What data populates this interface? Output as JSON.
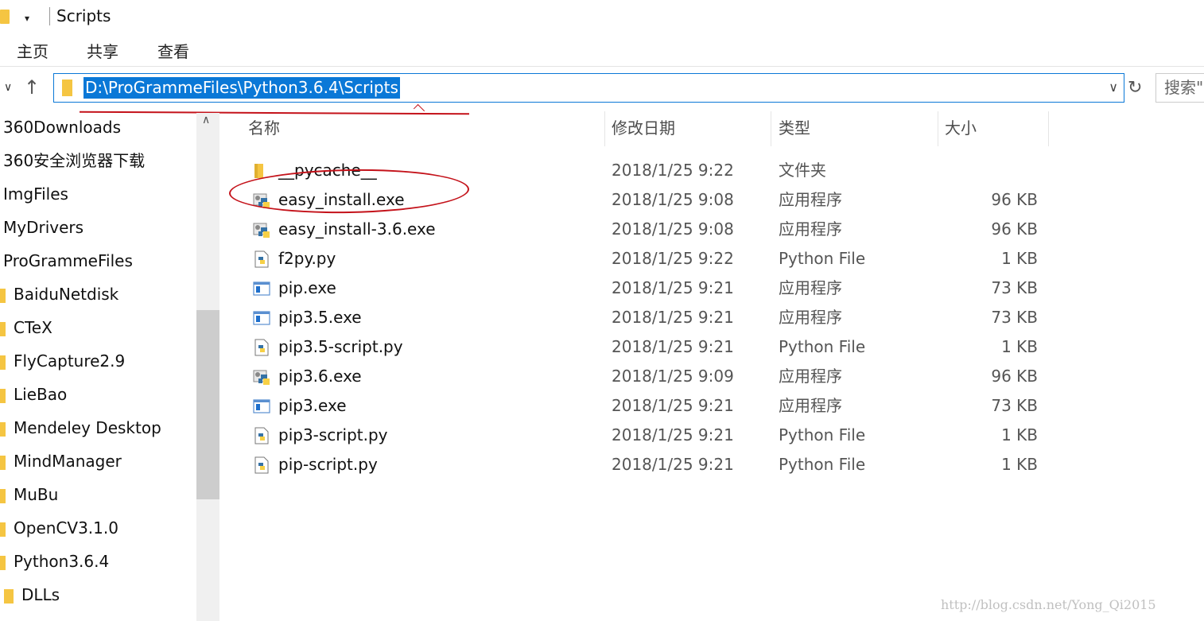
{
  "window": {
    "title": "Scripts",
    "folder_icon": "folder-icon",
    "quick_access_arrow": "▾"
  },
  "ribbon": {
    "tabs": [
      {
        "label": "主页"
      },
      {
        "label": "共享"
      },
      {
        "label": "查看"
      }
    ]
  },
  "address_bar": {
    "path": "D:\\ProGrammeFiles\\Python3.6.4\\Scripts",
    "search_placeholder": "搜索\"",
    "accent_color": "#0a78d7"
  },
  "sidebar": {
    "items": [
      {
        "label": "360Downloads",
        "folder": false
      },
      {
        "label": "360安全浏览器下载",
        "folder": false
      },
      {
        "label": "ImgFiles",
        "folder": false
      },
      {
        "label": "MyDrivers",
        "folder": false
      },
      {
        "label": "ProGrammeFiles",
        "folder": false
      },
      {
        "label": "BaiduNetdisk",
        "folder": true
      },
      {
        "label": "CTeX",
        "folder": true
      },
      {
        "label": "FlyCapture2.9",
        "folder": true
      },
      {
        "label": "LieBao",
        "folder": true
      },
      {
        "label": "Mendeley Desktop",
        "folder": true
      },
      {
        "label": "MindManager",
        "folder": true
      },
      {
        "label": "MuBu",
        "folder": true
      },
      {
        "label": "OpenCV3.1.0",
        "folder": true
      },
      {
        "label": "Python3.6.4",
        "folder": true
      },
      {
        "label": "DLLs",
        "folder": true,
        "sub": true
      }
    ]
  },
  "columns": {
    "name": "名称",
    "date": "修改日期",
    "type": "类型",
    "size": "大小"
  },
  "files": [
    {
      "name": "__pycache__",
      "date": "2018/1/25 9:22",
      "type": "文件夹",
      "size": "",
      "icon": "folder-icon"
    },
    {
      "name": "easy_install.exe",
      "date": "2018/1/25 9:08",
      "type": "应用程序",
      "size": "96 KB",
      "icon": "python-exe-icon"
    },
    {
      "name": "easy_install-3.6.exe",
      "date": "2018/1/25 9:08",
      "type": "应用程序",
      "size": "96 KB",
      "icon": "python-exe-icon"
    },
    {
      "name": "f2py.py",
      "date": "2018/1/25 9:22",
      "type": "Python File",
      "size": "1 KB",
      "icon": "python-file-icon"
    },
    {
      "name": "pip.exe",
      "date": "2018/1/25 9:21",
      "type": "应用程序",
      "size": "73 KB",
      "icon": "app-window-icon"
    },
    {
      "name": "pip3.5.exe",
      "date": "2018/1/25 9:21",
      "type": "应用程序",
      "size": "73 KB",
      "icon": "app-window-icon"
    },
    {
      "name": "pip3.5-script.py",
      "date": "2018/1/25 9:21",
      "type": "Python File",
      "size": "1 KB",
      "icon": "python-file-icon"
    },
    {
      "name": "pip3.6.exe",
      "date": "2018/1/25 9:09",
      "type": "应用程序",
      "size": "96 KB",
      "icon": "python-exe-icon"
    },
    {
      "name": "pip3.exe",
      "date": "2018/1/25 9:21",
      "type": "应用程序",
      "size": "73 KB",
      "icon": "app-window-icon"
    },
    {
      "name": "pip3-script.py",
      "date": "2018/1/25 9:21",
      "type": "Python File",
      "size": "1 KB",
      "icon": "python-file-icon"
    },
    {
      "name": "pip-script.py",
      "date": "2018/1/25 9:21",
      "type": "Python File",
      "size": "1 KB",
      "icon": "python-file-icon"
    }
  ],
  "annotation_color": "#c4121a",
  "watermark": "http://blog.csdn.net/Yong_Qi2015"
}
